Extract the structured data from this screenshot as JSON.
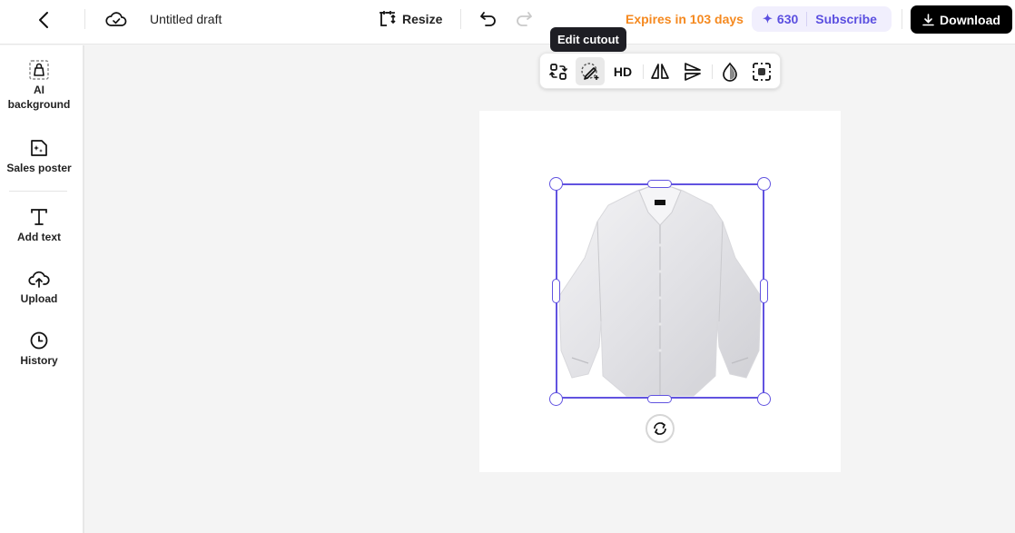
{
  "topbar": {
    "back_icon": "chevron-left-icon",
    "cloud_icon": "cloud-check-icon",
    "title": "Untitled draft",
    "resize_label": "Resize",
    "undo_icon": "undo-icon",
    "redo_icon": "redo-icon",
    "expires_text": "Expires in 103 days",
    "credits": "630",
    "credits_icon": "sparkle-icon",
    "subscribe_label": "Subscribe",
    "download_label": "Download",
    "accent_color": "#5b4fe0",
    "expires_color": "#f5891f"
  },
  "sidebar": {
    "items": [
      {
        "label_line1": "AI",
        "label_line2": "background",
        "icon": "shopping-bag-dashed-icon"
      },
      {
        "label": "Sales poster",
        "icon": "sparkle-image-icon"
      },
      {
        "label": "Add text",
        "icon": "text-icon"
      },
      {
        "label": "Upload",
        "icon": "cloud-upload-icon"
      },
      {
        "label": "History",
        "icon": "clock-icon"
      }
    ]
  },
  "floating_toolbar": {
    "tooltip": "Edit cutout",
    "hd_label": "HD",
    "buttons": [
      "replace-icon",
      "edit-cutout-icon",
      "hd-button",
      "flip-horizontal-icon",
      "flip-vertical-icon",
      "opacity-icon",
      "focus-icon"
    ]
  },
  "canvas": {
    "object": "white dress shirt",
    "selection_color": "#6153e0",
    "rotate_icon": "rotate-icon"
  }
}
